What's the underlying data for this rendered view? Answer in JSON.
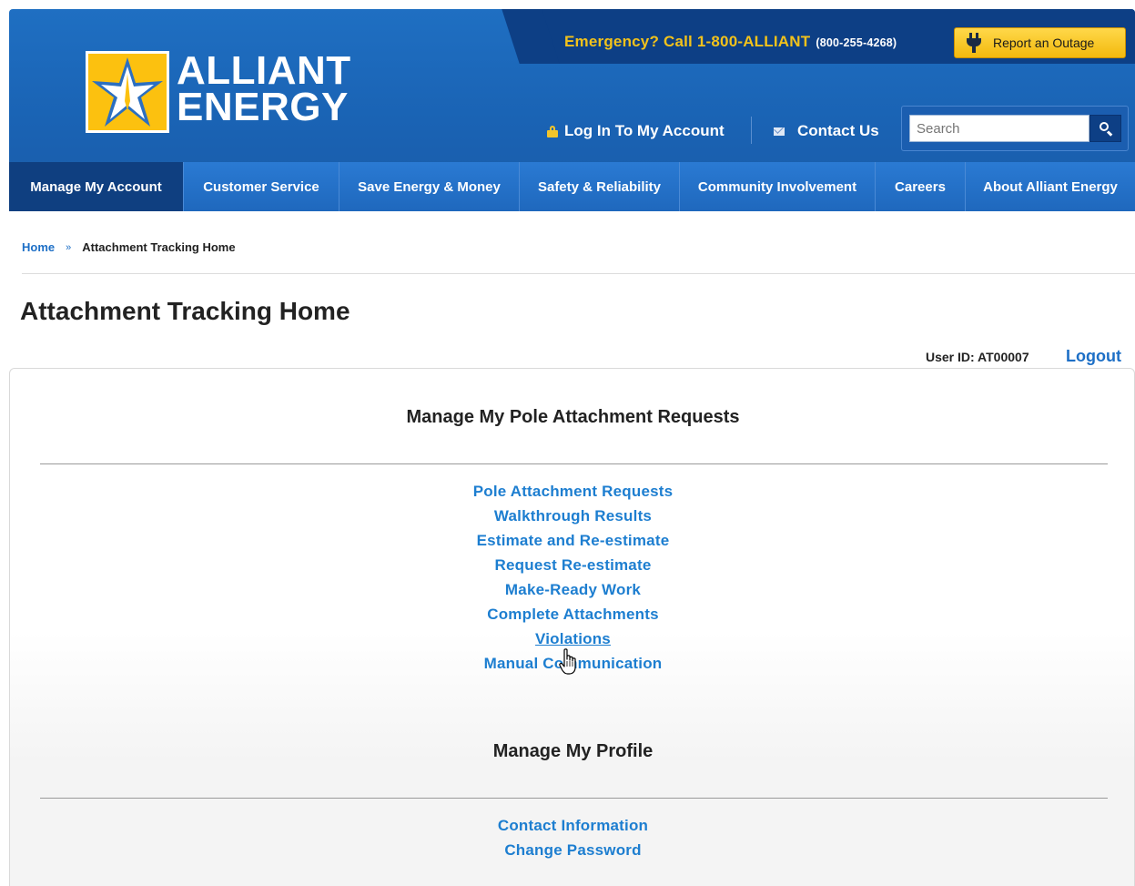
{
  "header": {
    "emergency_text": "Emergency? Call 1-800-ALLIANT",
    "emergency_number": "(800-255-4268)",
    "outage_button": "Report an Outage",
    "logo_line1": "ALLIANT",
    "logo_line2": "ENERGY",
    "login_link": "Log In To My Account",
    "contact_link": "Contact Us",
    "search_placeholder": "Search",
    "search_value": "Search"
  },
  "nav": {
    "items": [
      {
        "label": "Manage My Account"
      },
      {
        "label": "Customer Service"
      },
      {
        "label": "Save Energy & Money"
      },
      {
        "label": "Safety & Reliability"
      },
      {
        "label": "Community Involvement"
      },
      {
        "label": "Careers"
      },
      {
        "label": "About Alliant Energy"
      }
    ]
  },
  "breadcrumb": {
    "home": "Home",
    "separator": "»",
    "current": "Attachment Tracking Home"
  },
  "page": {
    "title": "Attachment Tracking Home",
    "user_id_label": "User ID:  AT00007",
    "logout": "Logout"
  },
  "sections": {
    "requests": {
      "title": "Manage My Pole Attachment Requests",
      "links": [
        "Pole Attachment Requests",
        "Walkthrough Results",
        "Estimate and Re-estimate",
        "Request Re-estimate",
        "Make-Ready Work",
        "Complete Attachments",
        "Violations",
        "Manual Communication"
      ]
    },
    "profile": {
      "title": "Manage My Profile",
      "links": [
        "Contact Information",
        "Change Password"
      ]
    }
  },
  "colors": {
    "header_blue": "#1a63b4",
    "nav_active": "#0f3f80",
    "emergency_yellow": "#f2c21b",
    "link_blue": "#1d7ed0",
    "outage_button": "#f3b90d"
  }
}
